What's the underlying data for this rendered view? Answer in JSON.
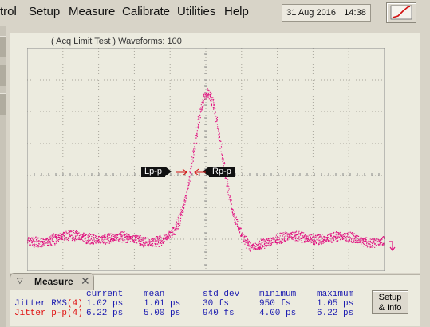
{
  "menu": {
    "items": [
      "trol",
      "Setup",
      "Measure",
      "Calibrate",
      "Utilities",
      "Help"
    ]
  },
  "status": {
    "date": "31 Aug 2016",
    "time": "14:38"
  },
  "scope": {
    "acq_text": "( Acq Limit Test )  Waveforms: 100",
    "markers": {
      "left": "Lp-p",
      "right": "Rp-p"
    },
    "trace_color": "#e0107f"
  },
  "measure": {
    "tab_label": "Measure",
    "columns": [
      "current",
      "mean",
      "std dev",
      "minimum",
      "maximum"
    ],
    "rows": [
      {
        "label": "Jitter RMS",
        "source": "(4)",
        "color": "#1a1ab0",
        "values": [
          "1.02 ps",
          "1.01 ps",
          "30 fs",
          "950 fs",
          "1.05 ps"
        ]
      },
      {
        "label": "Jitter p-p",
        "source": "(4)",
        "color": "#e01010",
        "values": [
          "6.22 ps",
          "5.00 ps",
          "940 fs",
          "4.00 ps",
          "6.22 ps"
        ]
      }
    ],
    "setup_button": [
      "Setup",
      "& Info"
    ]
  }
}
